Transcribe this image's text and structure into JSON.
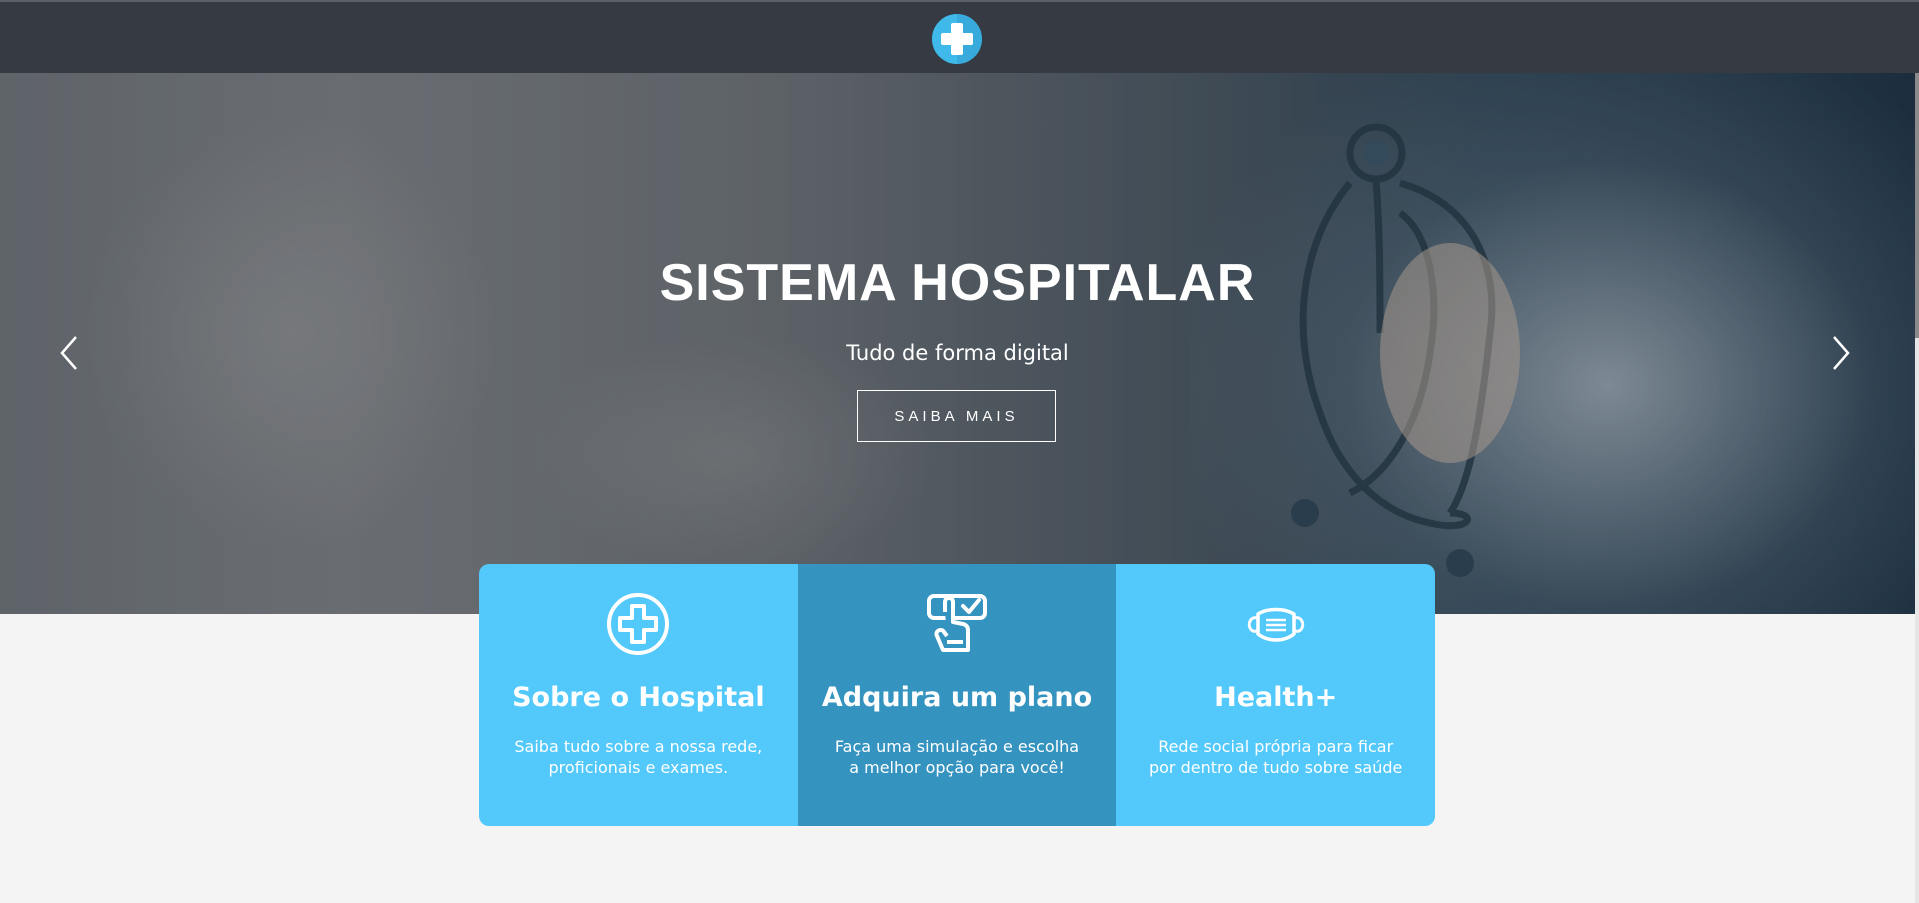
{
  "hero": {
    "title": "SISTEMA HOSPITALAR",
    "subtitle": "Tudo de forma digital",
    "button_label": "SAIBA MAIS"
  },
  "cards": [
    {
      "icon": "medical-cross-icon",
      "title": "Sobre o Hospital",
      "text": "Saiba tudo sobre a nossa rede, proficionais e exames."
    },
    {
      "icon": "touch-checklist-icon",
      "title": "Adquira um plano",
      "text": "Faça uma simulação e escolha a melhor opção para você!"
    },
    {
      "icon": "face-mask-icon",
      "title": "Health+",
      "text": "Rede social própria para ficar por dentro de tudo sobre saúde"
    }
  ],
  "colors": {
    "navbar": "#363a42",
    "accent": "#52c8fb",
    "accent_dark": "#3593c0",
    "logo": "#3fb9ea"
  }
}
